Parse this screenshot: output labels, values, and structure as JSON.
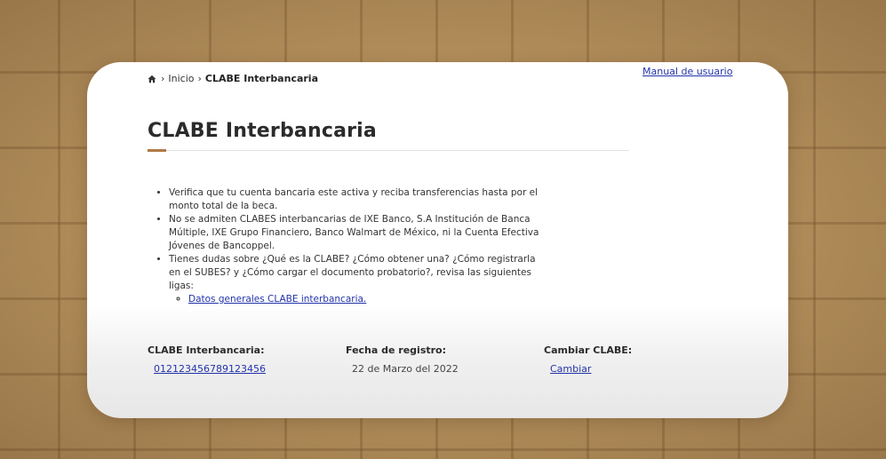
{
  "breadcrumb": {
    "home_icon": "home-icon",
    "separator": "›",
    "inicio": "Inicio",
    "current": "CLABE Interbancaria"
  },
  "header": {
    "manual_link": "Manual de usuario"
  },
  "page": {
    "title": "CLABE Interbancaria",
    "accent_color": "#b07a45"
  },
  "info": {
    "items": [
      "Verifica que tu cuenta bancaria este activa y reciba transferencias hasta por el monto total de la beca.",
      "No se admiten CLABES interbancarias de IXE Banco, S.A Institución de Banca Múltiple, IXE Grupo Financiero, Banco Walmart de México, ni la Cuenta Efectiva Jóvenes de Bancoppel.",
      "Tienes dudas sobre ¿Qué es la CLABE? ¿Cómo obtener una? ¿Cómo registrarla en el SUBES? y ¿Cómo cargar el documento probatorio?, revisa las siguientes ligas:"
    ],
    "sub_link": "Datos generales CLABE interbancaria."
  },
  "fields": {
    "clabe": {
      "label": "CLABE Interbancaria:",
      "value": "012123456789123456"
    },
    "fecha": {
      "label": "Fecha de registro:",
      "value": "22 de Marzo del 2022"
    },
    "cambiar": {
      "label": "Cambiar CLABE:",
      "value": "Cambiar"
    }
  },
  "colors": {
    "link": "#2233aa",
    "background": "#b8935f"
  }
}
